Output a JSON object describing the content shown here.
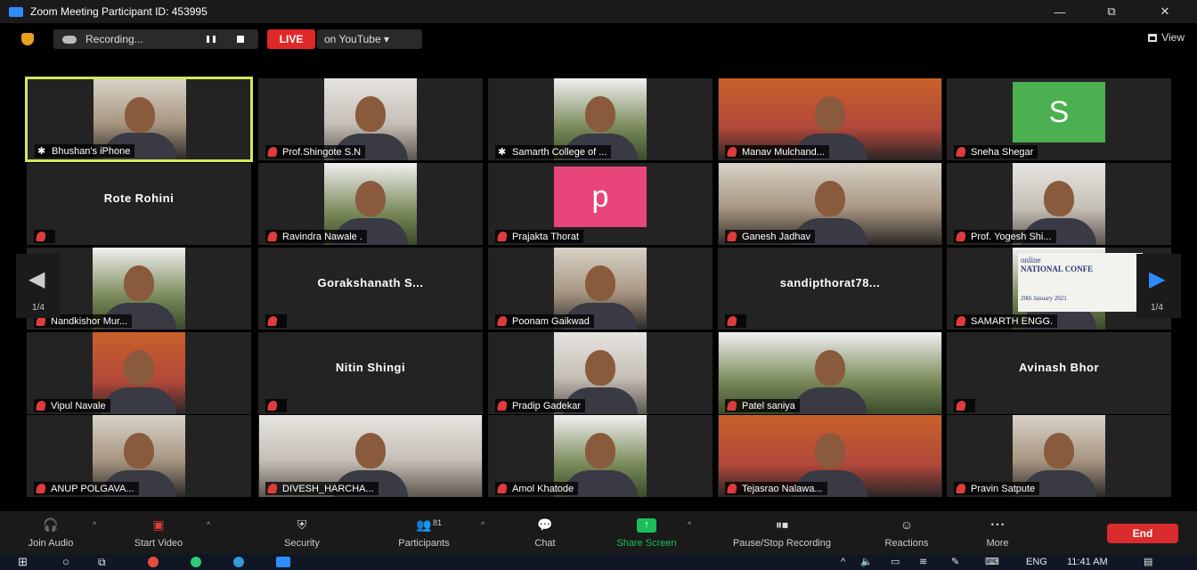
{
  "window": {
    "title": "Zoom Meeting Participant ID: 453995",
    "minimize": "—",
    "restore": "⧉",
    "close": "✕"
  },
  "topbar": {
    "recording": "Recording...",
    "live": "LIVE",
    "live_target": "on YouTube ▾",
    "view": "View"
  },
  "pager": {
    "page": "1/4",
    "page_right": "1/4"
  },
  "participants": [
    {
      "name": "Bhushan's iPhone",
      "kind": "video",
      "muted": false,
      "active": true
    },
    {
      "name": "Prof.Shingote S.N",
      "kind": "photo",
      "muted": true
    },
    {
      "name": "Samarth College of ...",
      "kind": "photo",
      "muted": false
    },
    {
      "name": "Manav Mulchand...",
      "kind": "video",
      "muted": true
    },
    {
      "name": "Sneha Shegar",
      "kind": "avatar",
      "initial": "S",
      "avatar_color": "#4caf50",
      "muted": true
    },
    {
      "name": "Rote Rohini",
      "kind": "text",
      "muted": true
    },
    {
      "name": "Ravindra Nawale .",
      "kind": "photo",
      "muted": true
    },
    {
      "name": "Prajakta Thorat",
      "kind": "avatar",
      "initial": "p",
      "avatar_color": "#e8457a",
      "muted": true
    },
    {
      "name": "Ganesh Jadhav",
      "kind": "video",
      "muted": true
    },
    {
      "name": "Prof. Yogesh Shi...",
      "kind": "video",
      "muted": true
    },
    {
      "name": "Nandkishor Mur...",
      "kind": "video",
      "muted": true
    },
    {
      "name": "Gorakshanath  S...",
      "kind": "text",
      "muted": true
    },
    {
      "name": "Poonam Gaikwad",
      "kind": "photo",
      "muted": true
    },
    {
      "name": "sandipthorat78...",
      "kind": "text",
      "muted": true
    },
    {
      "name": "SAMARTH ENGG.",
      "kind": "video",
      "muted": true
    },
    {
      "name": "Vipul Navale",
      "kind": "video",
      "muted": true
    },
    {
      "name": "Nitin Shingi",
      "kind": "text",
      "muted": true
    },
    {
      "name": "Pradip Gadekar",
      "kind": "photo",
      "muted": true
    },
    {
      "name": "Patel saniya",
      "kind": "video",
      "muted": true
    },
    {
      "name": "Avinash Bhor",
      "kind": "text",
      "muted": true
    },
    {
      "name": "ANUP POLGAVA...",
      "kind": "video",
      "muted": true
    },
    {
      "name": "DIVESH_HARCHA...",
      "kind": "video",
      "muted": true
    },
    {
      "name": "Amol Khatode",
      "kind": "video",
      "muted": true
    },
    {
      "name": "Tejasrao Nalawa...",
      "kind": "video",
      "muted": true
    },
    {
      "name": "Pravin Satpute",
      "kind": "video",
      "muted": true
    }
  ],
  "conference_banner": {
    "line1": "online",
    "line2": "NATIONAL CONFE",
    "date": "20th January 2021"
  },
  "toolbar": {
    "join_audio": "Join Audio",
    "start_video": "Start Video",
    "security": "Security",
    "participants": "Participants",
    "participants_count": "81",
    "chat": "Chat",
    "share_screen": "Share Screen",
    "pause_recording": "Pause/Stop Recording",
    "reactions": "Reactions",
    "more": "More",
    "more_dots": "• • •",
    "end": "End"
  },
  "taskbar": {
    "language": "ENG",
    "time": "11:41 AM"
  },
  "colors": {
    "active_border": "#d2e85a",
    "live": "#e02828",
    "end": "#d92c2c",
    "share": "#1bbf5a"
  }
}
